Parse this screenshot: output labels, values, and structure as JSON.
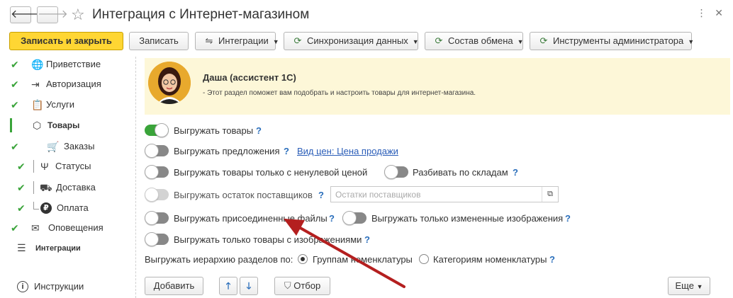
{
  "window": {
    "title": "Интеграция с Интернет-магазином",
    "back_icon": "arrow-left-icon",
    "forward_icon": "arrow-right-icon",
    "star_icon": "star-icon"
  },
  "toolbar": {
    "save_close": "Записать и закрыть",
    "save": "Записать",
    "integrations": "Интеграции",
    "sync": "Синхронизация данных",
    "exchange": "Состав обмена",
    "admin_tools": "Инструменты администратора"
  },
  "sidebar": {
    "items": [
      {
        "label": "Приветствие",
        "checked": true,
        "icon": "globe-icon"
      },
      {
        "label": "Авторизация",
        "checked": true,
        "icon": "login-icon"
      },
      {
        "label": "Услуги",
        "checked": true,
        "icon": "clipboard-icon"
      },
      {
        "label": "Товары",
        "checked": false,
        "icon": "box-icon",
        "active": true
      },
      {
        "label": "Заказы",
        "checked": true,
        "icon": "cart-icon"
      },
      {
        "label": "Статусы",
        "checked": true,
        "icon": "fork-icon"
      },
      {
        "label": "Доставка",
        "checked": true,
        "icon": "truck-icon"
      },
      {
        "label": "Оплата",
        "checked": true,
        "icon": "ruble-icon"
      },
      {
        "label": "Оповещения",
        "checked": true,
        "icon": "envelope-icon"
      },
      {
        "label": "Интеграции",
        "checked": false,
        "icon": "menu-icon"
      }
    ],
    "instructions": "Инструкции"
  },
  "assistant": {
    "name": "Даша (ассистент 1С)",
    "text": "- Этот раздел поможет вам подобрать и настроить товары для интернет-магазина."
  },
  "options": {
    "export_goods": "Выгружать товары",
    "export_offers": "Выгружать предложения",
    "price_link": "Вид цен: Цена продажи",
    "export_nonzero": "Выгружать товары только с ненулевой ценой",
    "split_warehouses": "Разбивать по складам",
    "export_supplier_stock": "Выгружать остаток поставщиков",
    "supplier_stock_placeholder": "Остатки поставщиков",
    "export_attached": "Выгружать присоединенные файлы",
    "export_changed_images": "Выгружать только измененные изображения",
    "export_with_images": "Выгружать только товары с изображениями",
    "hierarchy_label": "Выгружать иерархию разделов по:",
    "hierarchy_groups": "Группам номенклатуры",
    "hierarchy_categories": "Категориям номенклатуры",
    "help": "?"
  },
  "bottom": {
    "add": "Добавить",
    "filter": "Отбор",
    "more": "Еще"
  },
  "colors": {
    "primary_button": "#ffd633",
    "toggle_on": "#3aa43a",
    "check": "#3aa43a",
    "assistant_bg": "#fdf7d8",
    "annotation_arrow": "#b41f1f"
  }
}
